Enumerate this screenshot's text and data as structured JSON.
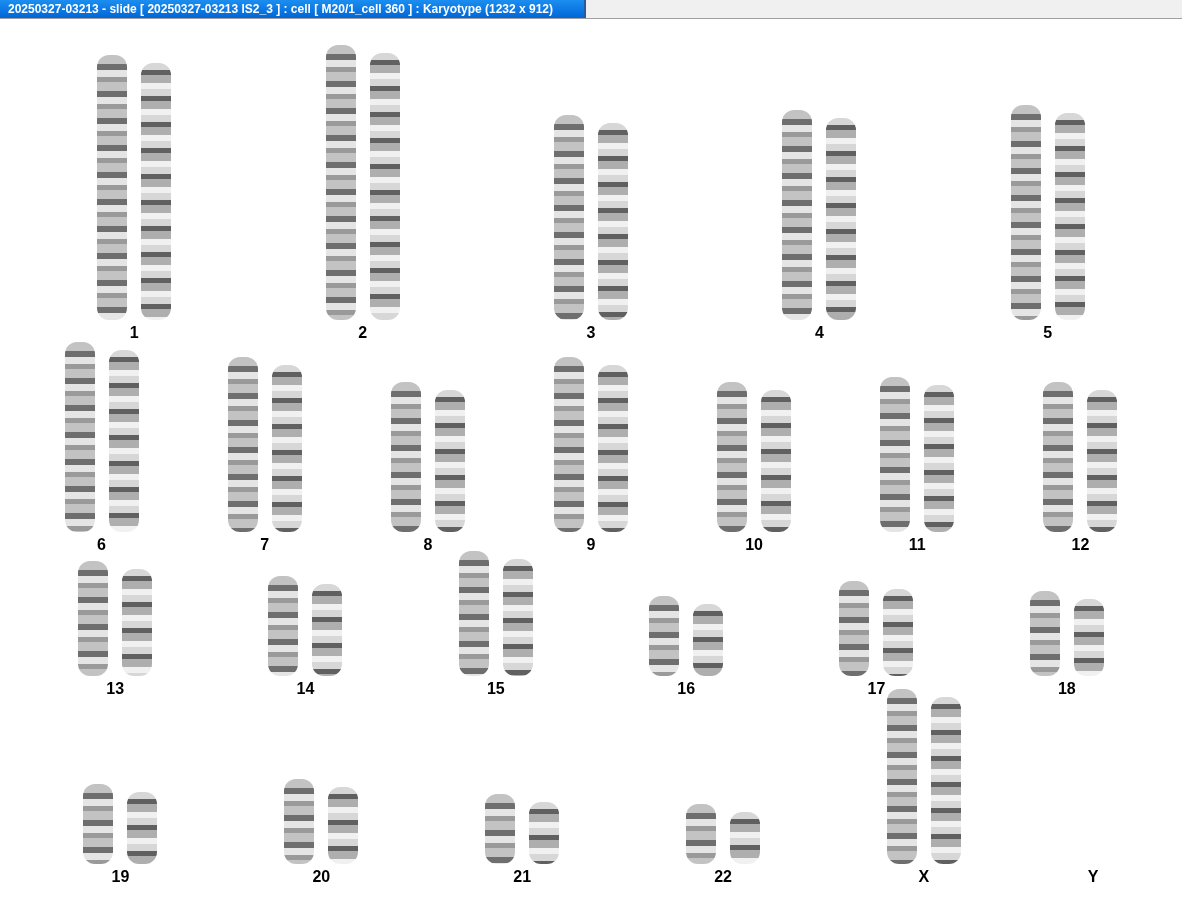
{
  "window": {
    "title": "20250327-03213 - slide [ 20250327-03213 IS2_3 ] : cell [ M20/1_cell 360 ] : Karyotype  (1232 x 912)"
  },
  "karyotype": {
    "rows": [
      {
        "pairs": [
          {
            "label": "1",
            "kind": "pair"
          },
          {
            "label": "2",
            "kind": "pair"
          },
          {
            "label": "3",
            "kind": "pair"
          },
          {
            "label": "4",
            "kind": "pair"
          },
          {
            "label": "5",
            "kind": "pair"
          }
        ]
      },
      {
        "pairs": [
          {
            "label": "6",
            "kind": "pair"
          },
          {
            "label": "7",
            "kind": "pair"
          },
          {
            "label": "8",
            "kind": "pair"
          },
          {
            "label": "9",
            "kind": "pair"
          },
          {
            "label": "10",
            "kind": "pair"
          },
          {
            "label": "11",
            "kind": "pair"
          },
          {
            "label": "12",
            "kind": "pair"
          }
        ]
      },
      {
        "pairs": [
          {
            "label": "13",
            "kind": "pair"
          },
          {
            "label": "14",
            "kind": "pair"
          },
          {
            "label": "15",
            "kind": "pair"
          },
          {
            "label": "16",
            "kind": "pair"
          },
          {
            "label": "17",
            "kind": "pair"
          },
          {
            "label": "18",
            "kind": "pair"
          }
        ]
      },
      {
        "pairs": [
          {
            "label": "19",
            "kind": "pair"
          },
          {
            "label": "20",
            "kind": "pair"
          },
          {
            "label": "21",
            "kind": "pair"
          },
          {
            "label": "22",
            "kind": "pair"
          },
          {
            "label": "X",
            "kind": "pair"
          },
          {
            "label": "Y",
            "kind": "empty"
          }
        ]
      }
    ]
  }
}
